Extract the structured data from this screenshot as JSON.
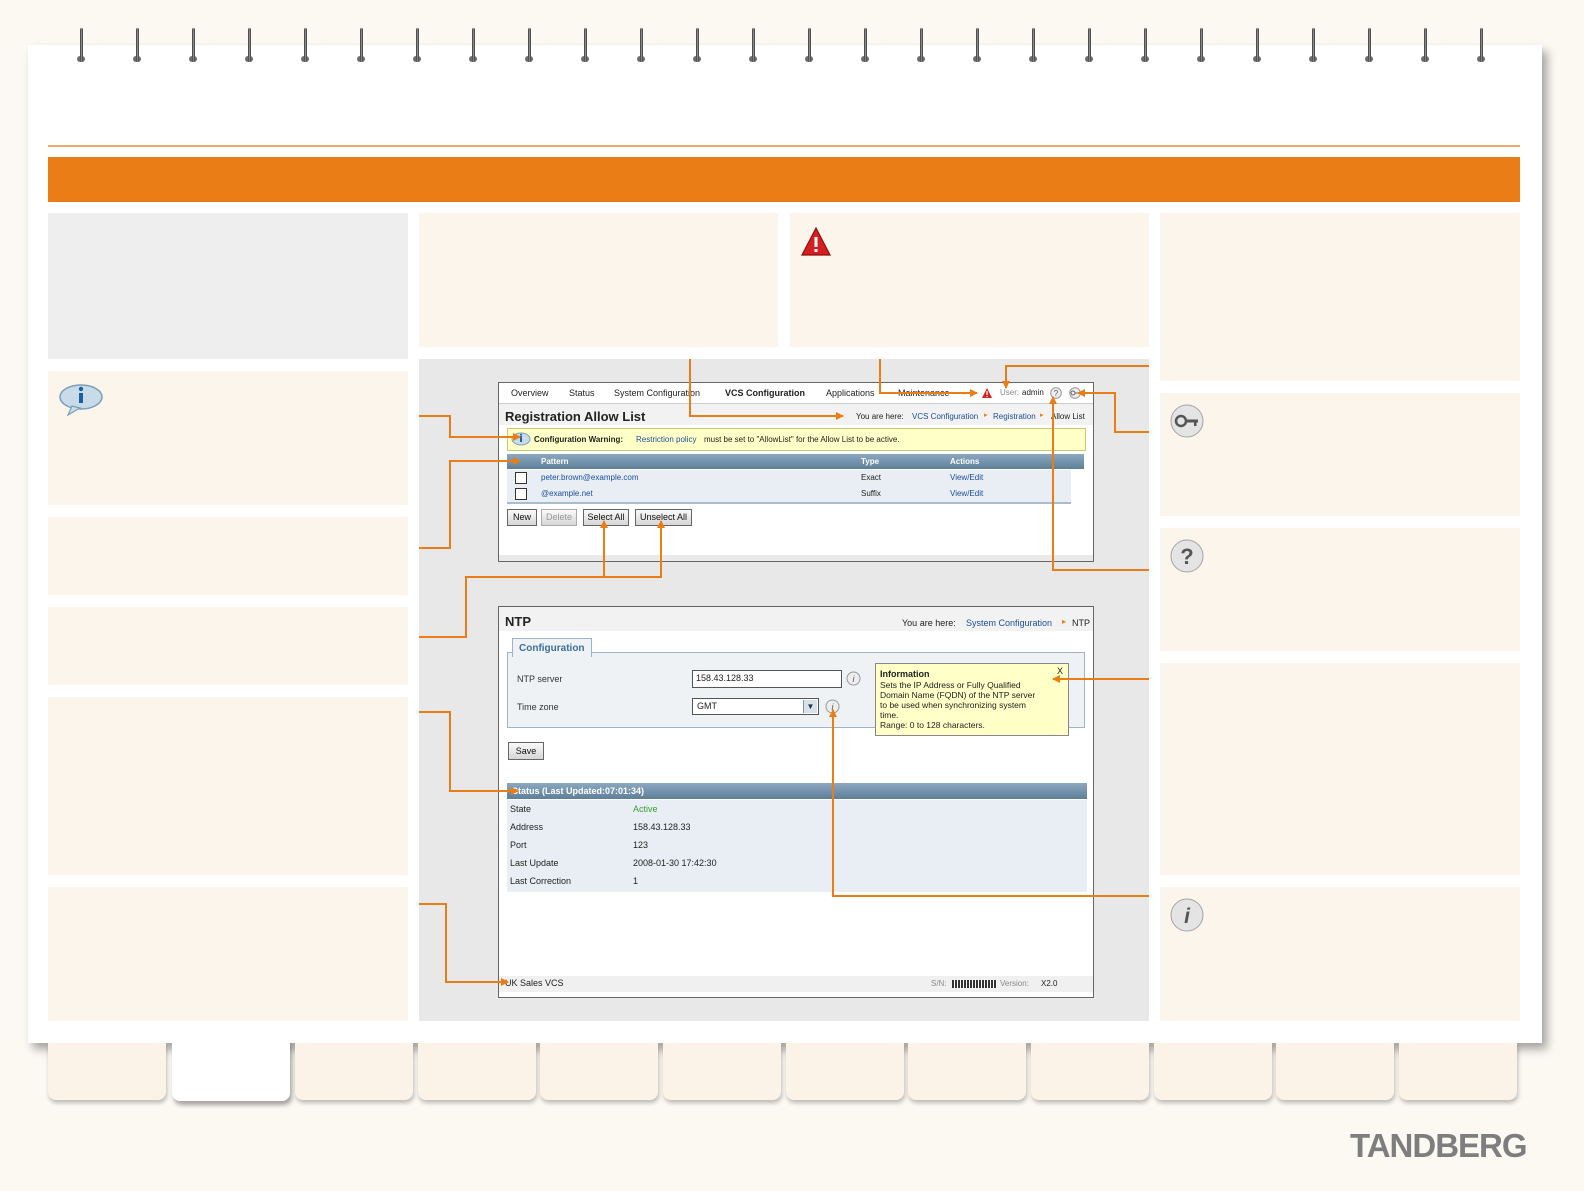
{
  "brand": {
    "logo": "TANDBERG",
    "accent": "#ea7d15"
  },
  "registration": {
    "menu": [
      "Overview",
      "Status",
      "System Configuration",
      "VCS Configuration",
      "Applications",
      "Maintenance"
    ],
    "user_label": "User:",
    "user_name": "admin",
    "title": "Registration Allow List",
    "breadcrumb_prefix": "You are here:",
    "breadcrumb": [
      "VCS Configuration",
      "Registration",
      "Allow List"
    ],
    "warning_label": "Configuration Warning:",
    "warning_link": "Restriction policy",
    "warning_text": "must be set to \"AllowList\" for the Allow List to be active.",
    "table": {
      "headers": [
        "Pattern",
        "Type",
        "Actions"
      ],
      "rows": [
        {
          "pattern": "peter.brown@example.com",
          "type": "Exact",
          "action": "View/Edit"
        },
        {
          "pattern": "@example.net",
          "type": "Suffix",
          "action": "View/Edit"
        }
      ]
    },
    "buttons": [
      "New",
      "Delete",
      "Select All",
      "Unselect All"
    ]
  },
  "ntp": {
    "title": "NTP",
    "breadcrumb_prefix": "You are here:",
    "breadcrumb": [
      "System Configuration",
      "NTP"
    ],
    "section": "Configuration",
    "server_label": "NTP server",
    "server_value": "158.43.128.33",
    "timezone_label": "Time zone",
    "timezone_value": "GMT",
    "save": "Save",
    "info": {
      "title": "Information",
      "close": "X",
      "lines": [
        "Sets the IP Address or Fully Qualified",
        "Domain Name (FQDN) of the NTP server",
        "to be used when synchronizing system",
        "time.",
        "Range: 0 to 128 characters."
      ]
    },
    "status_title": "Status (Last Updated:07:01:34)",
    "status": [
      {
        "label": "State",
        "value": "Active"
      },
      {
        "label": "Address",
        "value": "158.43.128.33"
      },
      {
        "label": "Port",
        "value": "123"
      },
      {
        "label": "Last Update",
        "value": "2008-01-30 17:42:30"
      },
      {
        "label": "Last Correction",
        "value": "1"
      }
    ],
    "footer_system": "UK Sales VCS",
    "footer_sn_label": "S/N:",
    "footer_version_label": "Version:",
    "footer_version": "X2.0"
  }
}
